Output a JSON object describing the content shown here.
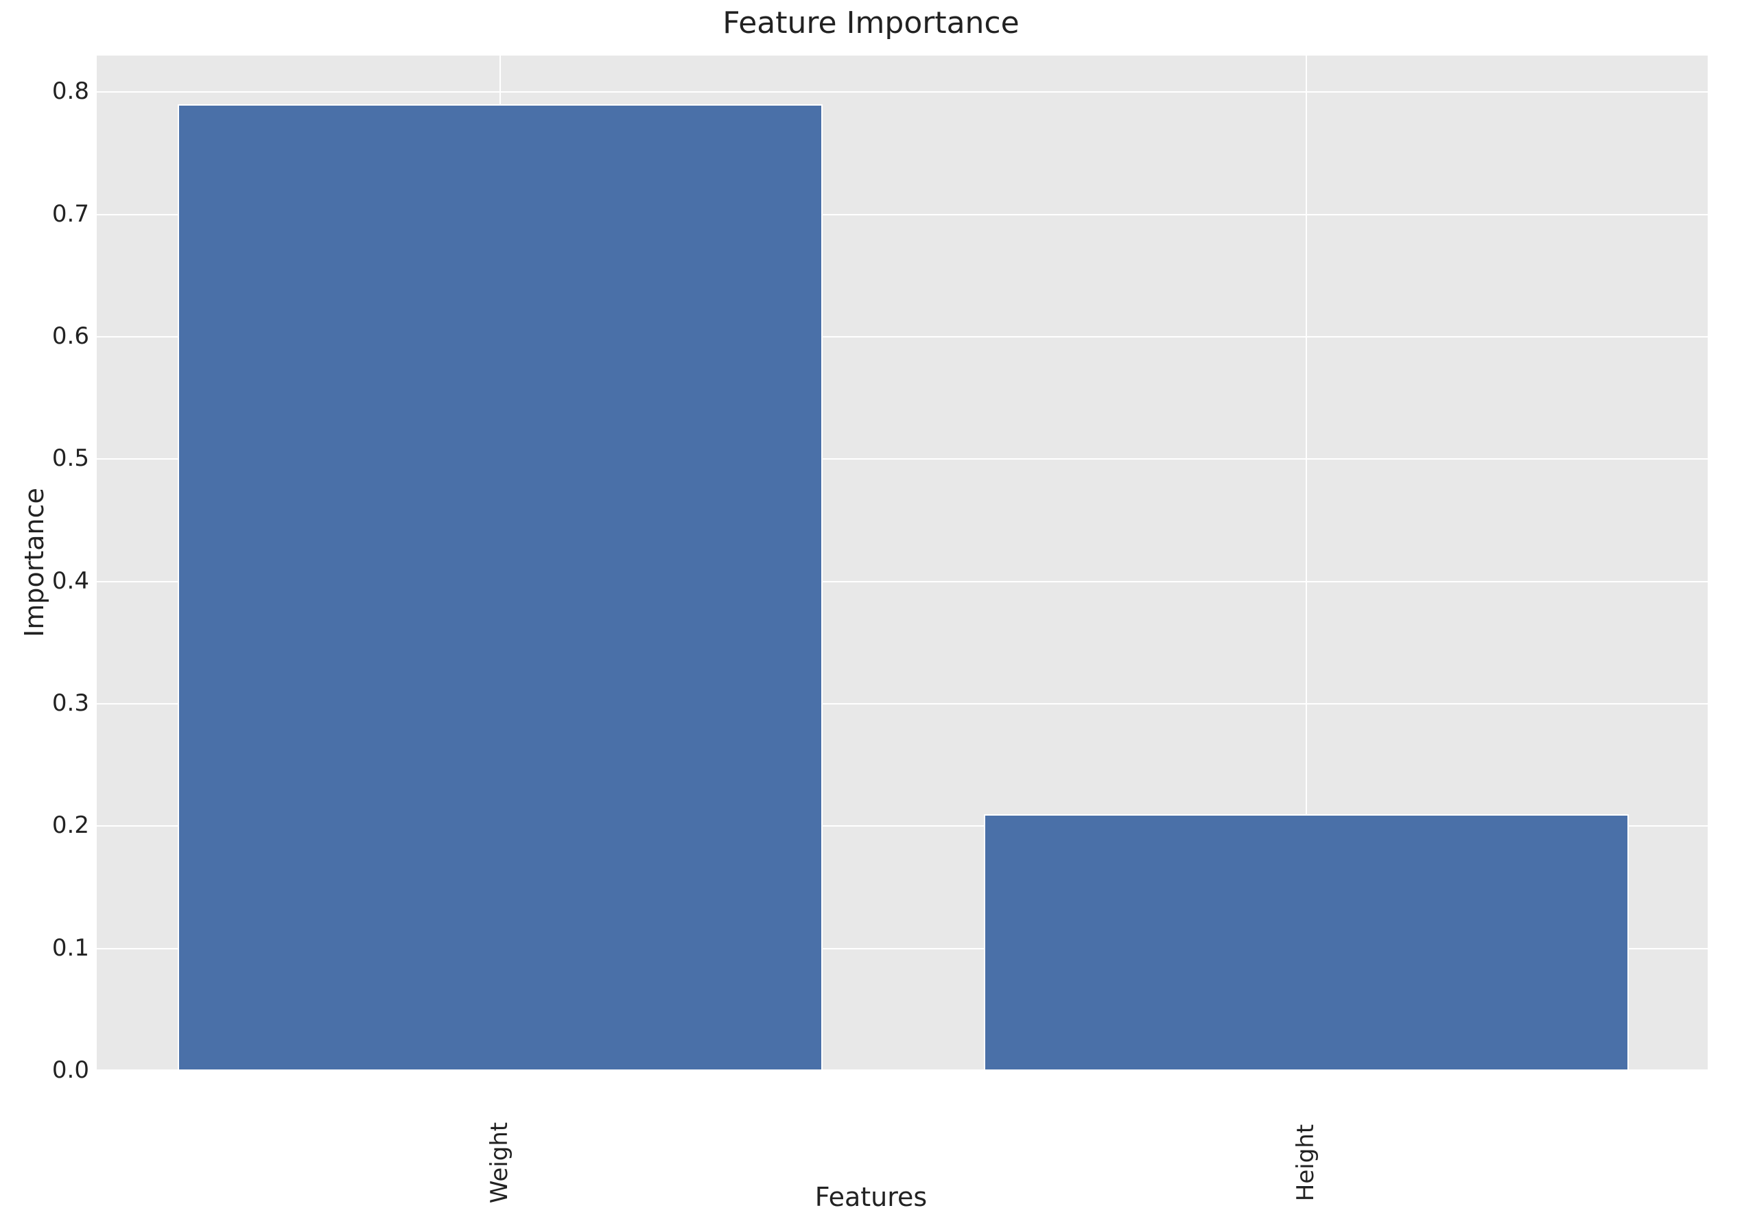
{
  "chart_data": {
    "type": "bar",
    "title": "Feature Importance",
    "xlabel": "Features",
    "ylabel": "Importance",
    "categories": [
      "Weight",
      "Height"
    ],
    "values": [
      0.79,
      0.21
    ],
    "ylim": [
      0.0,
      0.83
    ],
    "yticks": [
      0.0,
      0.1,
      0.2,
      0.3,
      0.4,
      0.5,
      0.6,
      0.7,
      0.8
    ],
    "ytick_labels": [
      "0.0",
      "0.1",
      "0.2",
      "0.3",
      "0.4",
      "0.5",
      "0.6",
      "0.7",
      "0.8"
    ],
    "bar_color": "#4a70a8",
    "plot_bg": "#e8e8e8"
  }
}
